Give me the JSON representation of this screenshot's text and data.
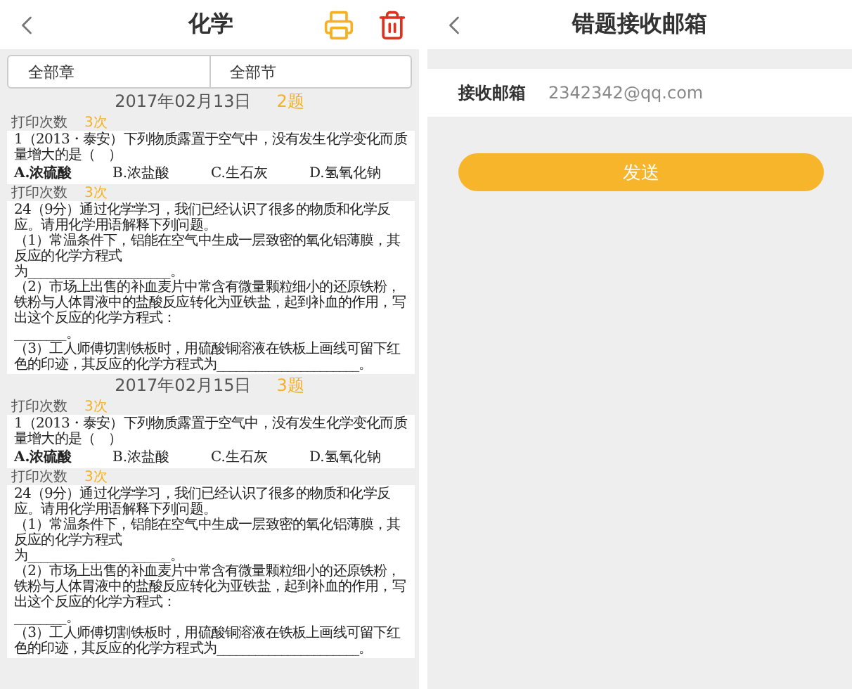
{
  "left": {
    "title": "化学",
    "filters": [
      "全部章",
      "全部节"
    ],
    "groups": [
      {
        "date": "2017年02月13日",
        "count": "2题",
        "items": [
          {
            "kind": "choice",
            "print_label": "打印次数",
            "print_count": "3次",
            "stem": "1（2013・泰安）下列物质露置于空气中，没有发生化学变化而质量增大的是（　）",
            "options": [
              "A.浓硫酸",
              "B.浓盐酸",
              "C.生石灰",
              "D.氢氧化钠"
            ]
          },
          {
            "kind": "essay",
            "print_label": "打印次数",
            "print_count": "3次",
            "lines": [
              "24（9分）通过化学学习，我们已经认识了很多的物质和化学反应。请用化学用语解释下列问题。",
              "（1）常温条件下，铝能在空气中生成一层致密的氧化铝薄膜，其反应的化学方程式",
              "为______________________。",
              "（2）市场上出售的补血麦片中常含有微量颗粒细小的还原铁粉，铁粉与人体胃液中的盐酸反应转化为亚铁盐，起到补血的作用，写出这个反应的化学方程式：",
              "________。",
              "（3）工人师傅切割铁板时，用硫酸铜溶液在铁板上画线可留下红色的印迹，其反应的化学方程式为______________________。"
            ]
          }
        ]
      },
      {
        "date": "2017年02月15日",
        "count": "3题",
        "items": [
          {
            "kind": "choice",
            "print_label": "打印次数",
            "print_count": "3次",
            "stem": "1（2013・泰安）下列物质露置于空气中，没有发生化学变化而质量增大的是（　）",
            "options": [
              "A.浓硫酸",
              "B.浓盐酸",
              "C.生石灰",
              "D.氢氧化钠"
            ]
          },
          {
            "kind": "essay",
            "print_label": "打印次数",
            "print_count": "3次",
            "lines": [
              "24（9分）通过化学学习，我们已经认识了很多的物质和化学反应。请用化学用语解释下列问题。",
              "（1）常温条件下，铝能在空气中生成一层致密的氧化铝薄膜，其反应的化学方程式",
              "为______________________。",
              "（2）市场上出售的补血麦片中常含有微量颗粒细小的还原铁粉，铁粉与人体胃液中的盐酸反应转化为亚铁盐，起到补血的作用，写出这个反应的化学方程式：",
              "________。",
              "（3）工人师傅切割铁板时，用硫酸铜溶液在铁板上画线可留下红色的印迹，其反应的化学方程式为______________________。"
            ]
          }
        ]
      }
    ]
  },
  "right": {
    "title": "错题接收邮箱",
    "field_label": "接收邮箱",
    "field_value": "2342342@qq.com",
    "button": "发送"
  }
}
